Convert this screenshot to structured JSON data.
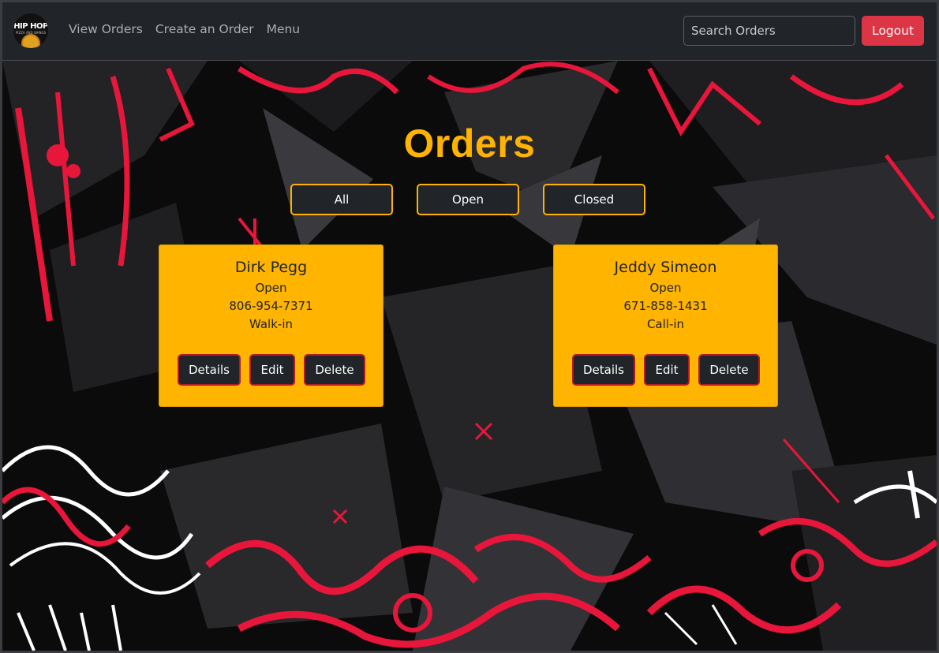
{
  "navbar": {
    "logo_text": "HIP HOP",
    "logo_subtext": "PIZZA AND WANGS",
    "links": [
      "View Orders",
      "Create an Order",
      "Menu"
    ],
    "search_placeholder": "Search Orders",
    "logout_label": "Logout"
  },
  "page": {
    "title": "Orders",
    "filters": [
      "All",
      "Open",
      "Closed"
    ]
  },
  "orders": [
    {
      "name": "Dirk Pegg",
      "status": "Open",
      "phone": "806-954-7371",
      "type": "Walk-in"
    },
    {
      "name": "Jeddy Simeon",
      "status": "Open",
      "phone": "671-858-1431",
      "type": "Call-in"
    }
  ],
  "card_buttons": {
    "details": "Details",
    "edit": "Edit",
    "delete": "Delete"
  },
  "colors": {
    "accent": "#ffb300",
    "danger": "#dc3545",
    "dark": "#212529",
    "graffiti_red": "#e8163a"
  }
}
